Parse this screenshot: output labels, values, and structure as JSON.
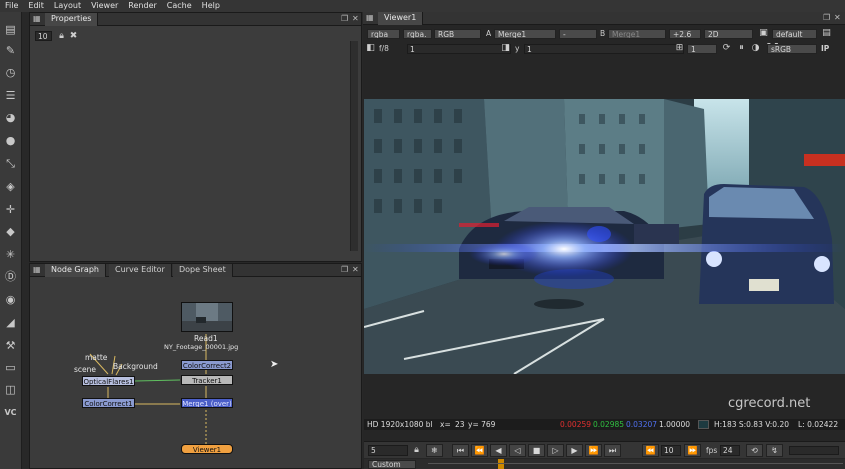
{
  "menu": [
    "File",
    "Edit",
    "Layout",
    "Viewer",
    "Render",
    "Cache",
    "Help"
  ],
  "toolbar_icons": [
    "image-icon",
    "paint-brush-icon",
    "clock-icon",
    "channel-icon",
    "color-wheel-icon",
    "filter-icon",
    "keyer-icon",
    "merge-icon",
    "transform-icon",
    "3d-cube-icon",
    "particles-icon",
    "deep-icon",
    "views-icon",
    "metadata-icon",
    "tools-icon",
    "furnace-icon",
    "other-icon"
  ],
  "toolbar_vc": "VC",
  "properties": {
    "tab": "Properties",
    "max_panels": "10"
  },
  "nodegraph": {
    "tabs": [
      "Node Graph",
      "Curve Editor",
      "Dope Sheet"
    ],
    "nodes": {
      "read": "Read1",
      "read_file": "NY_Footage_00001.jpg",
      "cc_top": "ColorCorrect2",
      "tracker": "Tracker1",
      "flares": "OpticalFlares1",
      "cc_left": "ColorCorrect1",
      "merge": "Merge1 (over)",
      "viewer": "Viewer1"
    },
    "inputs": {
      "matte": "matte",
      "scene": "scene",
      "background": "Background"
    }
  },
  "viewer": {
    "tab": "Viewer1",
    "row1": {
      "channels": "rgba",
      "alpha": "rgba.",
      "mode": "RGB",
      "a_label": "A",
      "a_input": "Merge1",
      "wipe": "-",
      "b_label": "B",
      "b_input": "Merge1",
      "gain": "+2.6",
      "view": "2D",
      "lut": "default"
    },
    "row2": {
      "fstop": "f/8",
      "gain_value": "1",
      "y_label": "y",
      "gamma_value": "1",
      "proxy": "1",
      "colorspace": "sRGB",
      "ip": "IP"
    },
    "info": {
      "format": "HD 1920x1080 bl",
      "x_label": "x=",
      "x_val": "23",
      "y_val": "y= 769",
      "r": "0.00259",
      "g": "0.02985",
      "b": "0.03207",
      "a": "1.00000",
      "hsvl": "H:183 S:0.83 V:0.20",
      "l": "L: 0.02422"
    },
    "transport": {
      "frame": "5",
      "increment": "10",
      "fps_label": "fps",
      "fps": "24",
      "range": "Custom"
    },
    "watermark": "cgrecord.net"
  },
  "colors": {
    "r": "#e03030",
    "g": "#30c040",
    "b": "#4060e0",
    "viewer_accent": "#cc8800"
  }
}
